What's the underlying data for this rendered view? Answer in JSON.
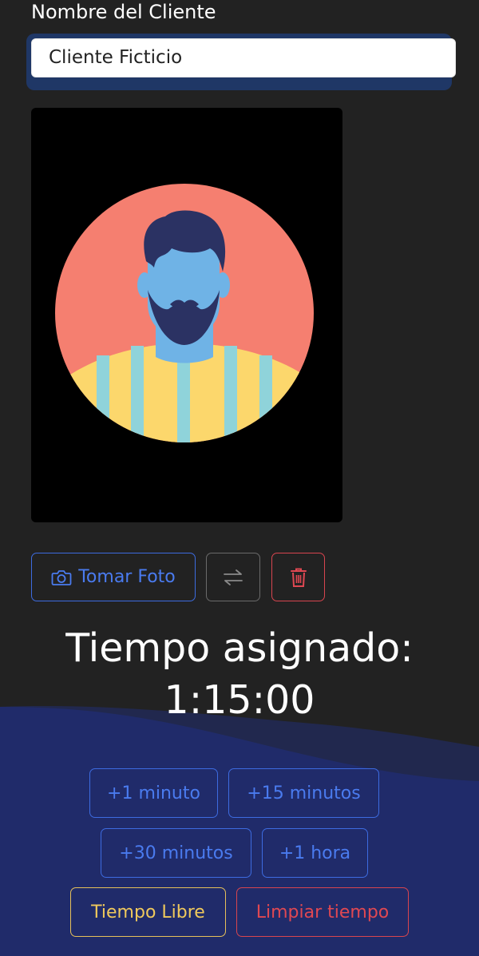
{
  "client": {
    "label": "Nombre del Cliente",
    "value": "Cliente Ficticio"
  },
  "photo": {
    "avatar_icon": "man-avatar-illustration"
  },
  "photo_actions": {
    "take_photo_label": "Tomar Foto",
    "take_photo_icon": "camera-icon",
    "switch_camera_icon": "switch-camera-icon",
    "delete_icon": "trash-icon"
  },
  "timer": {
    "title": "Tiempo asignado:",
    "value": "1:15:00"
  },
  "time_buttons": {
    "add_1_min": "+1 minuto",
    "add_15_min": "+15 minutos",
    "add_30_min": "+30 minutos",
    "add_1_hour": "+1 hora",
    "free_time": "Tiempo Libre",
    "clear_time": "Limpiar tiempo"
  },
  "colors": {
    "background": "#222222",
    "wave": "#1f2a66",
    "accent_blue": "#3d6be0",
    "danger_red": "#d8454f",
    "warning_yellow": "#e6c15a"
  }
}
